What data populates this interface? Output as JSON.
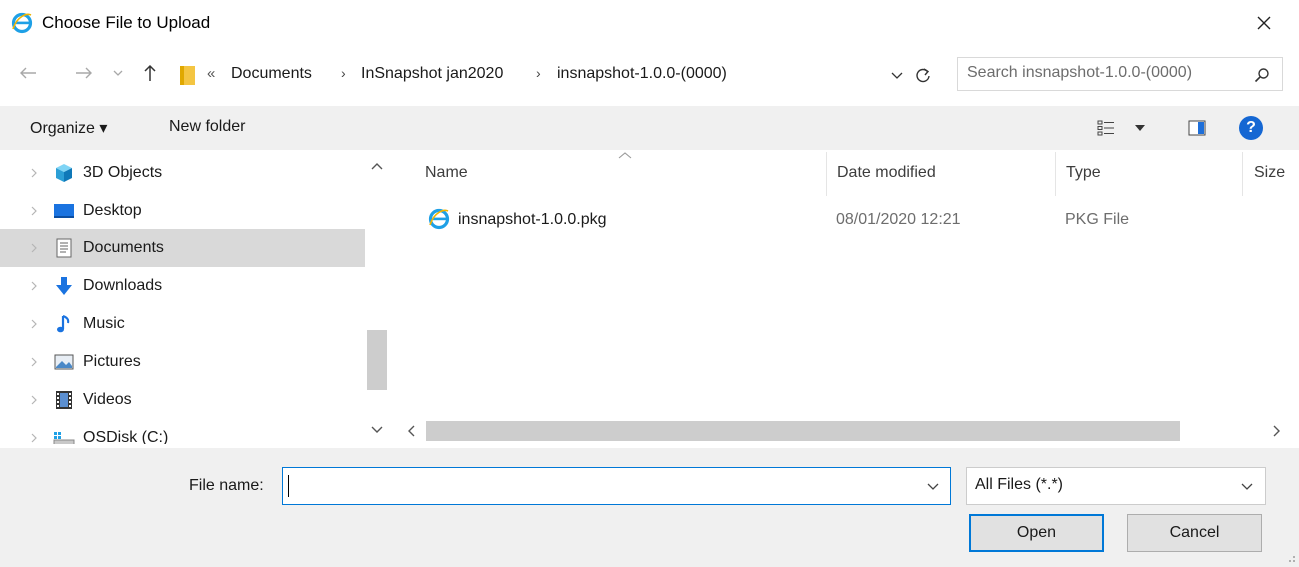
{
  "window": {
    "title": "Choose File to Upload",
    "title_icon": "internet-explorer-icon",
    "close_icon": "close-icon"
  },
  "address_bar": {
    "overflow_marker": "«",
    "breadcrumbs": [
      "Documents",
      "InSnapshot jan2020",
      "insnapshot-1.0.0-(0000)"
    ],
    "separator": "›",
    "search_placeholder": "Search insnapshot-1.0.0-(0000)"
  },
  "toolbar": {
    "organize_label": "Organize ▾",
    "new_folder_label": "New folder",
    "help_label": "?"
  },
  "navigation": {
    "items": [
      {
        "label": "3D Objects",
        "icon": "3d-objects-icon",
        "selected": false
      },
      {
        "label": "Desktop",
        "icon": "desktop-icon",
        "selected": false
      },
      {
        "label": "Documents",
        "icon": "documents-icon",
        "selected": true
      },
      {
        "label": "Downloads",
        "icon": "downloads-icon",
        "selected": false
      },
      {
        "label": "Music",
        "icon": "music-icon",
        "selected": false
      },
      {
        "label": "Pictures",
        "icon": "pictures-icon",
        "selected": false
      },
      {
        "label": "Videos",
        "icon": "videos-icon",
        "selected": false
      },
      {
        "label": "OSDisk (C:)",
        "icon": "drive-icon",
        "selected": false
      }
    ]
  },
  "file_list": {
    "columns": {
      "name": "Name",
      "date_modified": "Date modified",
      "type": "Type",
      "size": "Size"
    },
    "sort_column": "Name",
    "rows": [
      {
        "name": "insnapshot-1.0.0.pkg",
        "date_modified": "08/01/2020 12:21",
        "type": "PKG File",
        "icon": "internet-explorer-icon"
      }
    ]
  },
  "footer": {
    "file_name_label": "File name:",
    "file_name_value": "",
    "file_type_value": "All Files (*.*)",
    "open_label": "Open",
    "cancel_label": "Cancel"
  },
  "colors": {
    "accent": "#0078d7",
    "selected_bg": "#d9d9d9",
    "panel_bg": "#f0f0f0",
    "help_blue": "#1567d3",
    "ie_blue": "#1ea0e6",
    "folder_yellow": "#f4c542"
  }
}
